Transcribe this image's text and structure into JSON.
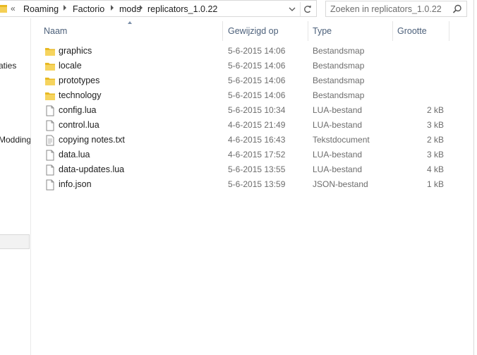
{
  "address": {
    "overflow": "«",
    "crumbs": [
      "Roaming",
      "Factorio",
      "mods",
      "replicators_1.0.22"
    ]
  },
  "search": {
    "placeholder": "Zoeken in replicators_1.0.22"
  },
  "nav": {
    "items": [
      "aties",
      "Modding"
    ]
  },
  "columns": {
    "name": "Naam",
    "modified": "Gewijzigd op",
    "type": "Type",
    "size": "Grootte"
  },
  "files": [
    {
      "name": "graphics",
      "date": "5-6-2015 14:06",
      "type": "Bestandsmap",
      "size": "",
      "icon": "folder-icon"
    },
    {
      "name": "locale",
      "date": "5-6-2015 14:06",
      "type": "Bestandsmap",
      "size": "",
      "icon": "folder-icon"
    },
    {
      "name": "prototypes",
      "date": "5-6-2015 14:06",
      "type": "Bestandsmap",
      "size": "",
      "icon": "folder-icon"
    },
    {
      "name": "technology",
      "date": "5-6-2015 14:06",
      "type": "Bestandsmap",
      "size": "",
      "icon": "folder-icon"
    },
    {
      "name": "config.lua",
      "date": "5-6-2015 10:34",
      "type": "LUA-bestand",
      "size": "2 kB",
      "icon": "file-icon"
    },
    {
      "name": "control.lua",
      "date": "4-6-2015 21:49",
      "type": "LUA-bestand",
      "size": "3 kB",
      "icon": "file-icon"
    },
    {
      "name": "copying notes.txt",
      "date": "4-6-2015 16:43",
      "type": "Tekstdocument",
      "size": "2 kB",
      "icon": "text-file-icon"
    },
    {
      "name": "data.lua",
      "date": "4-6-2015 17:52",
      "type": "LUA-bestand",
      "size": "3 kB",
      "icon": "file-icon"
    },
    {
      "name": "data-updates.lua",
      "date": "5-6-2015 13:55",
      "type": "LUA-bestand",
      "size": "4 kB",
      "icon": "file-icon"
    },
    {
      "name": "info.json",
      "date": "5-6-2015 13:59",
      "type": "JSON-bestand",
      "size": "1 kB",
      "icon": "file-icon"
    }
  ],
  "colors": {
    "folder": "#e8b923",
    "header_text": "#4c607a",
    "secondary_text": "#6d6d6d"
  }
}
